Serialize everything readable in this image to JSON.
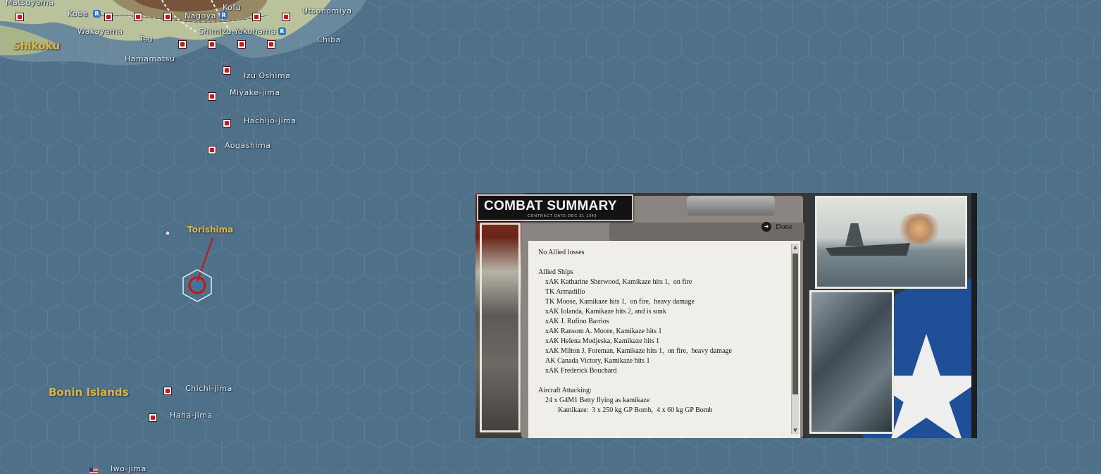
{
  "map": {
    "regions": [
      {
        "name": "Shikoku"
      },
      {
        "name": "Bonin Islands"
      },
      {
        "name": "Torishima"
      }
    ],
    "cities": [
      "Matsuyama",
      "Kobe",
      "Wakayama",
      "Tsu",
      "Nagoya",
      "Kofu",
      "Shimizu",
      "Yokohama",
      "Utsonomiya",
      "Chiba",
      "Hamamatsu",
      "Izu Oshima",
      "Miyake-jima",
      "Hachijo-jima",
      "Aogashima",
      "Chichi-jima",
      "Haha-jima",
      "Iwo-jima"
    ],
    "base_badge": "R"
  },
  "combat_summary": {
    "title": "COMBAT SUMMARY",
    "subtitle": "CONTRACT DATE DEC 31 1943",
    "done_label": "Done",
    "report_lines": [
      {
        "text": "",
        "indent": 0
      },
      {
        "text": "No Allied losses",
        "indent": 0
      },
      {
        "text": "",
        "indent": 0
      },
      {
        "text": "Allied Ships",
        "indent": 0
      },
      {
        "text": "xAK Katharine Sherwood, Kamikaze hits 1,  on fire",
        "indent": 1
      },
      {
        "text": "TK Armadillo",
        "indent": 1
      },
      {
        "text": "TK Moose, Kamikaze hits 1,  on fire,  heavy damage",
        "indent": 1
      },
      {
        "text": "xAK Iolanda, Kamikaze hits 2, and is sunk",
        "indent": 1
      },
      {
        "text": "xAK J. Rufino Barrios",
        "indent": 1
      },
      {
        "text": "xAK Ransom A. Moore, Kamikaze hits 1",
        "indent": 1
      },
      {
        "text": "xAK Helena Modjeska, Kamikaze hits 1",
        "indent": 1
      },
      {
        "text": "xAK Milton J. Foreman, Kamikaze hits 1,  on fire,  heavy damage",
        "indent": 1
      },
      {
        "text": "AK Canada Victory, Kamikaze hits 1",
        "indent": 1
      },
      {
        "text": "xAK Frederick Bouchard",
        "indent": 1
      },
      {
        "text": "",
        "indent": 0
      },
      {
        "text": "Aircraft Attacking:",
        "indent": 0
      },
      {
        "text": "24 x G4M1 Betty flying as kamikaze",
        "indent": 1
      },
      {
        "text": "Kamikaze:  3 x 250 kg GP Bomb,  4 x 60 kg GP Bomb",
        "indent": 2
      }
    ]
  },
  "colors": {
    "ocean": "#4f7089",
    "hexline": "#5e7f97",
    "region_label": "#d9b64a",
    "japan_flag_red": "#c8141a",
    "allied_blue": "#1f4f97"
  }
}
